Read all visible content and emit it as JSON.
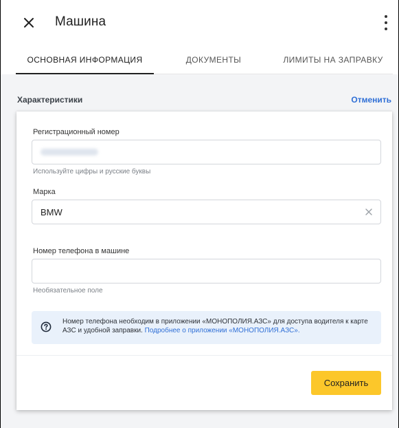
{
  "header": {
    "title": "Машина"
  },
  "tabs": [
    {
      "label": "Основная информация",
      "active": true
    },
    {
      "label": "Документы",
      "active": false
    },
    {
      "label": "Лимиты на заправку",
      "active": false
    }
  ],
  "section": {
    "title": "Характеристики",
    "cancel_label": "Отменить"
  },
  "form": {
    "registration": {
      "label": "Регистрационный номер",
      "value": "",
      "helper": "Используйте цифры и русские буквы"
    },
    "brand": {
      "label": "Марка",
      "value": "BMW"
    },
    "phone": {
      "label": "Номер телефона в машине",
      "value": "",
      "helper": "Необязательное поле"
    }
  },
  "info": {
    "text": "Номер телефона необходим в приложении «МОНОПОЛИЯ.АЗС» для доступа водителя к карте АЗС и удобной заправки.",
    "link": "Подробнее о приложении «МОНОПОЛИЯ.АЗС»."
  },
  "actions": {
    "save_label": "Сохранить"
  },
  "colors": {
    "accent_yellow": "#fcc72a",
    "link_blue": "#2f6fd6",
    "info_bg": "#e9f1fb",
    "page_bg": "#f3f4f6"
  }
}
